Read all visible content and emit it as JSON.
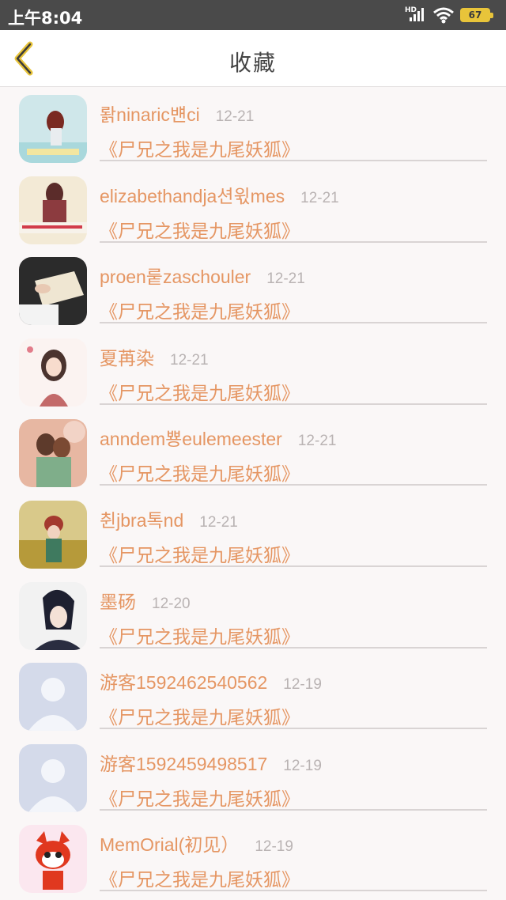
{
  "status_bar": {
    "time": "上午8:04",
    "network_label": "HD",
    "battery": "67",
    "icons": [
      "signal-icon",
      "wifi-icon",
      "battery-icon"
    ]
  },
  "nav": {
    "title": "收藏",
    "back_icon": "chevron-left-icon"
  },
  "colors": {
    "accent": "#e59663",
    "date": "#b9b3b3",
    "back_icon": "#e8c43a",
    "status_bar": "#4a4a4a"
  },
  "items": [
    {
      "name": "뢁ninaric뱬ci",
      "date": "12-21",
      "book": "《尸兄之我是九尾妖狐》",
      "avatar": "girl-beach-avatar"
    },
    {
      "name": "elizabethandja션윇mes",
      "date": "12-21",
      "book": "《尸兄之我是九尾妖狐》",
      "avatar": "girl-scarf-avatar"
    },
    {
      "name": "proen뤁zaschouler",
      "date": "12-21",
      "book": "《尸兄之我是九尾妖狐》",
      "avatar": "book-hands-avatar"
    },
    {
      "name": "夏苒染",
      "date": "12-21",
      "book": "《尸兄之我是九尾妖狐》",
      "avatar": "anime-girl-avatar"
    },
    {
      "name": "anndem뿅eulemeester",
      "date": "12-21",
      "book": "《尸兄之我是九尾妖狐》",
      "avatar": "couple-painting-avatar"
    },
    {
      "name": "췬jbra톡nd",
      "date": "12-21",
      "book": "《尸兄之我是九尾妖狐》",
      "avatar": "girl-field-avatar"
    },
    {
      "name": "墨砀",
      "date": "12-20",
      "book": "《尸兄之我是九尾妖狐》",
      "avatar": "anime-boy-avatar"
    },
    {
      "name": "游客1592462540562",
      "date": "12-19",
      "book": "《尸兄之我是九尾妖狐》",
      "avatar": "default-user-avatar"
    },
    {
      "name": "游客1592459498517",
      "date": "12-19",
      "book": "《尸兄之我是九尾妖狐》",
      "avatar": "default-user-avatar"
    },
    {
      "name": "MemOrial(初见）",
      "date": "12-19",
      "book": "《尸兄之我是九尾妖狐》",
      "avatar": "cartoon-fox-avatar"
    }
  ]
}
